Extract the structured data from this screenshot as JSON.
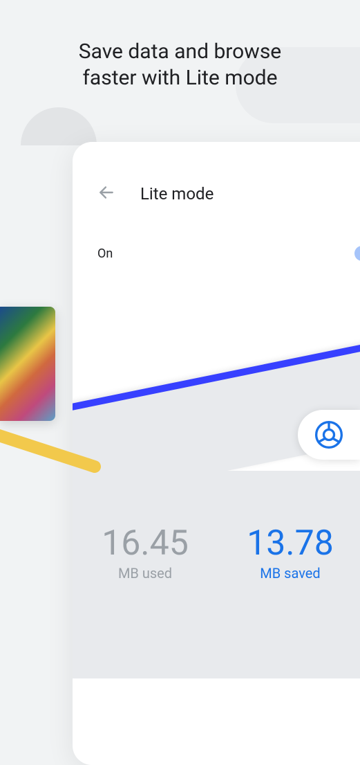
{
  "headline_line1": "Save data and browse",
  "headline_line2": "faster with Lite mode",
  "card": {
    "title": "Lite mode",
    "toggle_label": "On",
    "toggle_state": true
  },
  "stats": {
    "used_value": "16.45",
    "used_label": "MB used",
    "saved_value": "13.78",
    "saved_label": "MB saved"
  }
}
